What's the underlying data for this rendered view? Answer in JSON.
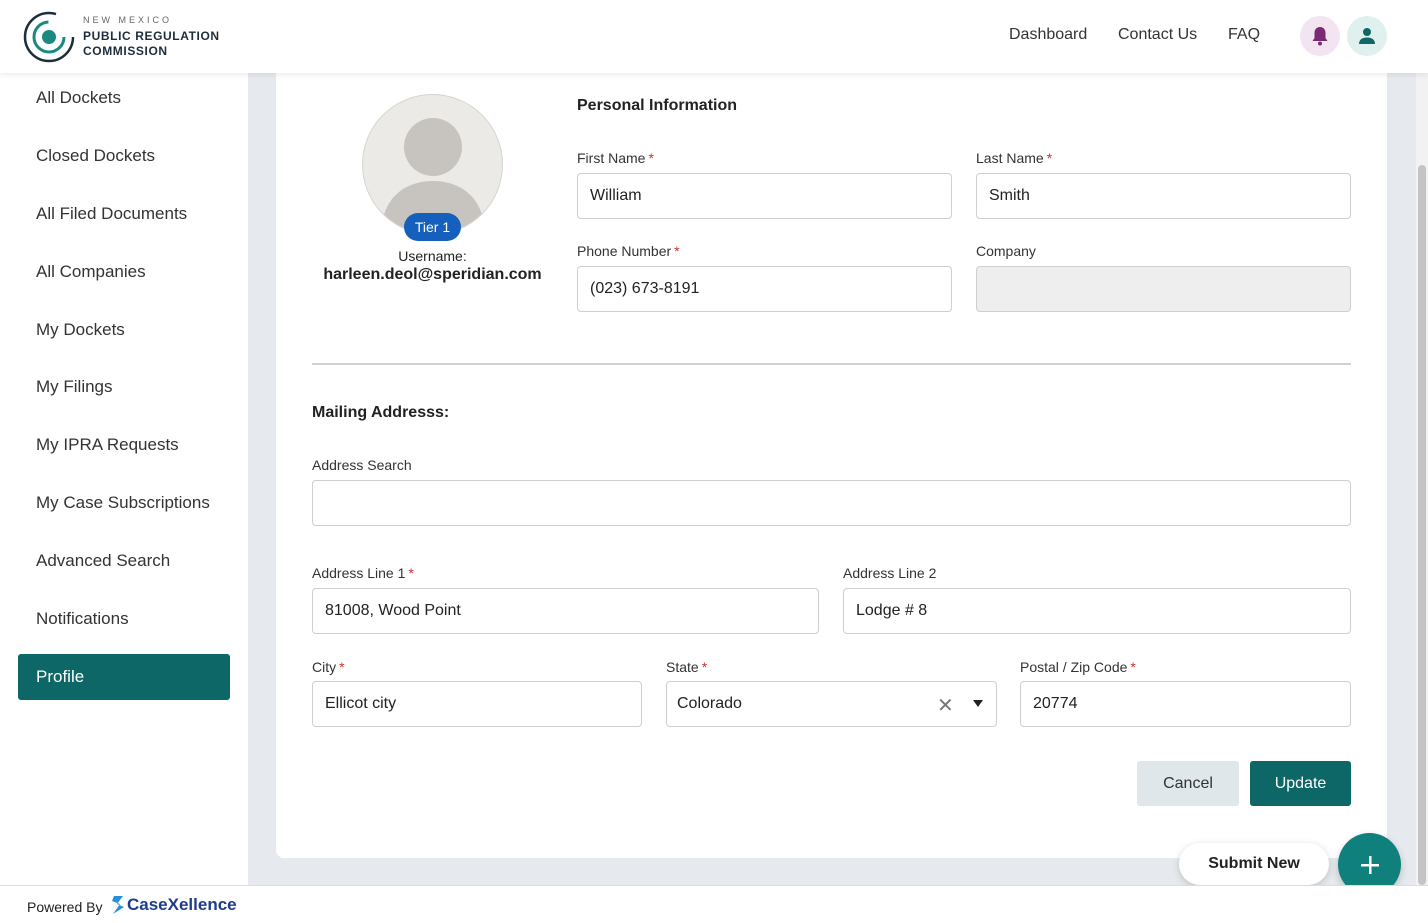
{
  "header": {
    "logo": {
      "line1": "NEW MEXICO",
      "line2": "PUBLIC REGULATION",
      "line3": "COMMISSION"
    },
    "nav": {
      "dashboard": "Dashboard",
      "contact": "Contact Us",
      "faq": "FAQ"
    },
    "icons": {
      "notifications": "bell-icon",
      "account": "user-icon"
    }
  },
  "sidebar": {
    "items": [
      {
        "label": "All Dockets"
      },
      {
        "label": "Closed Dockets"
      },
      {
        "label": "All Filed Documents"
      },
      {
        "label": "All Companies"
      },
      {
        "label": "My Dockets"
      },
      {
        "label": "My Filings"
      },
      {
        "label": "My IPRA Requests"
      },
      {
        "label": "My Case Subscriptions"
      },
      {
        "label": "Advanced Search"
      },
      {
        "label": "Notifications"
      },
      {
        "label": "Profile",
        "active": true
      }
    ]
  },
  "profile": {
    "tier": "Tier 1",
    "username_label": "Username:",
    "username": "harleen.deol@speridian.com"
  },
  "personal": {
    "title": "Personal Information",
    "first_name_label": "First Name",
    "first_name": "William",
    "last_name_label": "Last Name",
    "last_name": "Smith",
    "phone_label": "Phone Number",
    "phone": "(023) 673-8191",
    "company_label": "Company",
    "company": ""
  },
  "mailing": {
    "title": "Mailing Addresss:",
    "search_label": "Address Search",
    "search_value": "",
    "line1_label": "Address Line 1",
    "line1": "81008, Wood Point",
    "line2_label": "Address Line 2",
    "line2": "Lodge # 8",
    "city_label": "City",
    "city": "Ellicot city",
    "state_label": "State",
    "state": "Colorado",
    "zip_label": "Postal / Zip Code",
    "zip": "20774"
  },
  "actions": {
    "cancel": "Cancel",
    "update": "Update",
    "submit_new": "Submit New"
  },
  "footer": {
    "powered_by": "Powered By",
    "brand": "CaseXellence"
  },
  "colors": {
    "primary": "#0d6766",
    "tier_badge": "#1560bd",
    "required": "#d0312d",
    "brand": "#1f3c8a"
  }
}
